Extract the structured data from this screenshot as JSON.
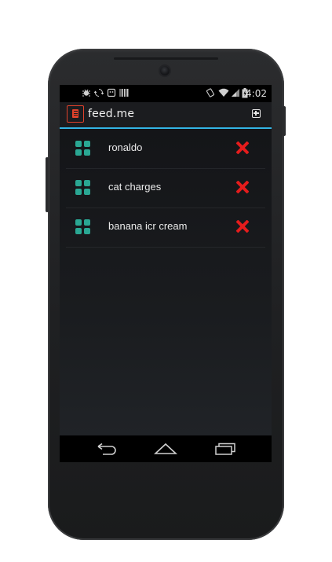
{
  "status_bar": {
    "time": "4:02",
    "left_icons": [
      "debug-icon",
      "sync-icon",
      "android-icon",
      "barcode-icon"
    ],
    "right_icons": [
      "rotate-icon",
      "wifi-icon",
      "signal-icon",
      "battery-icon"
    ]
  },
  "action_bar": {
    "app_icon": "notepad-icon",
    "title": "feed.me",
    "add_icon": "add-box-icon"
  },
  "list": {
    "items": [
      {
        "label": "ronaldo",
        "icon": "grid-icon",
        "action_icon": "delete-x-icon"
      },
      {
        "label": "cat charges",
        "icon": "grid-icon",
        "action_icon": "delete-x-icon"
      },
      {
        "label": "banana icr cream",
        "icon": "grid-icon",
        "action_icon": "delete-x-icon"
      }
    ]
  },
  "nav_bar": {
    "buttons": [
      "back-icon",
      "home-icon",
      "recent-apps-icon"
    ]
  },
  "colors": {
    "accent": "#33b5e5",
    "app_icon": "#e0412b",
    "grid_icon": "#2aa793",
    "delete": "#e51c1c"
  }
}
